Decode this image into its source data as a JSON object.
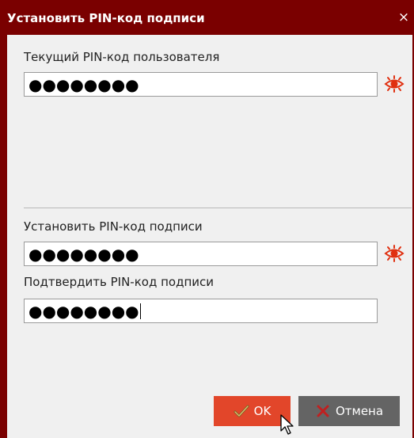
{
  "dialog": {
    "title": "Установить PIN-код подписи",
    "close_glyph": "×"
  },
  "current_pin": {
    "label": "Текущий PIN-код пользователя",
    "value_masked": "●●●●●●●●",
    "toggle_icon": "eye-icon"
  },
  "new_pin": {
    "label": "Установить PIN-код подписи",
    "value_masked": "●●●●●●●●",
    "toggle_icon": "eye-icon"
  },
  "confirm_pin": {
    "label": "Подтвердить PIN-код подписи",
    "value_masked": "●●●●●●●●"
  },
  "buttons": {
    "ok_label": "OK",
    "ok_icon": "checkmark-icon",
    "cancel_label": "Отмена",
    "cancel_icon": "cross-icon"
  },
  "colors": {
    "titlebar": "#7a0000",
    "accent_eye": "#e03010",
    "ok_button": "#e2462a",
    "cancel_button": "#646464"
  }
}
